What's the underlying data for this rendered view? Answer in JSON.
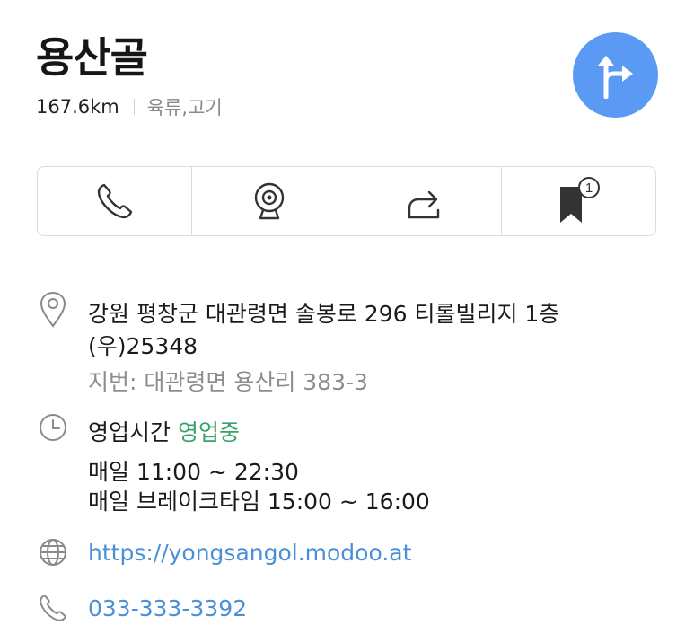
{
  "place": {
    "name": "용산골",
    "distance": "167.6km",
    "category": "육류,고기"
  },
  "actions": [
    {
      "name": "call",
      "icon": "phone-icon"
    },
    {
      "name": "street-view",
      "icon": "camera-icon"
    },
    {
      "name": "share",
      "icon": "share-icon"
    },
    {
      "name": "save",
      "icon": "bookmark-icon",
      "badge": "1"
    }
  ],
  "address": {
    "road": "강원 평창군 대관령면 솔봉로 296 티롤빌리지 1층",
    "postal": "(우)25348",
    "lot": "지번: 대관령면 용산리 383-3"
  },
  "hours": {
    "label": "영업시간",
    "status": "영업중",
    "line1": "매일 11:00 ~ 22:30",
    "line2": "매일 브레이크타임 15:00 ~ 16:00"
  },
  "website": "https://yongsangol.modoo.at",
  "phone": "033-333-3392",
  "colors": {
    "accent": "#5b9af4",
    "open": "#3aa36a",
    "link": "#4a8fd8"
  }
}
